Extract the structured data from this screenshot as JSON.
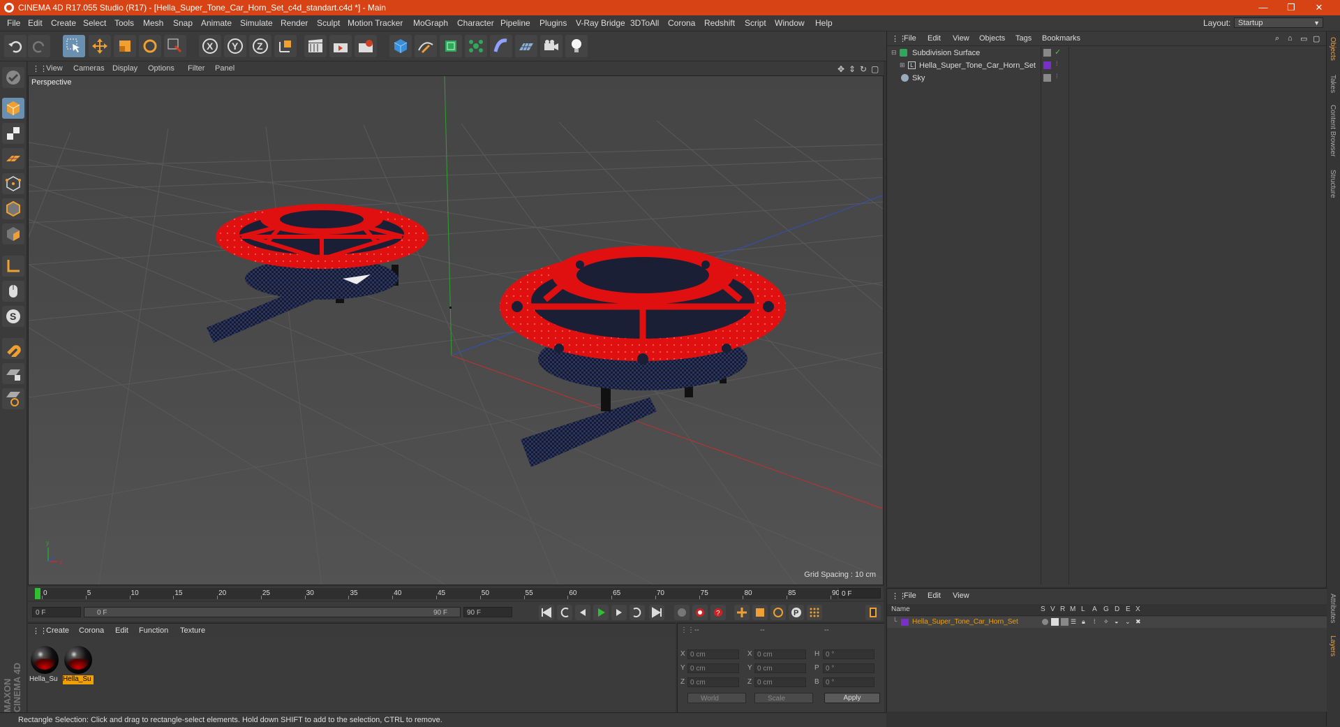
{
  "app": {
    "title": "CINEMA 4D R17.055 Studio (R17) - [Hella_Super_Tone_Car_Horn_Set_c4d_standart.c4d *] - Main",
    "window_controls": [
      "—",
      "❐",
      "✕"
    ]
  },
  "menubar": {
    "items": [
      "File",
      "Edit",
      "Create",
      "Select",
      "Tools",
      "Mesh",
      "Snap",
      "Animate",
      "Simulate",
      "Render",
      "Sculpt",
      "Motion Tracker",
      "MoGraph",
      "Character",
      "Pipeline",
      "Plugins",
      "V-Ray Bridge",
      "3DToAll",
      "Corona",
      "Redshift",
      "Script",
      "Window",
      "Help"
    ],
    "layout_label": "Layout:",
    "layout_value": "Startup"
  },
  "viewport": {
    "menu": [
      "View",
      "Cameras",
      "Display",
      "Options",
      "Filter",
      "Panel"
    ],
    "label": "Perspective",
    "grid_spacing": "Grid Spacing : 10 cm"
  },
  "object_manager": {
    "menu": [
      "File",
      "Edit",
      "View",
      "Objects",
      "Tags",
      "Bookmarks"
    ],
    "objects": [
      {
        "name": "Subdivision Surface"
      },
      {
        "name": "Hella_Super_Tone_Car_Horn_Set"
      },
      {
        "name": "Sky"
      }
    ]
  },
  "right_tabs": [
    "Objects",
    "Takes",
    "Content Browser",
    "Structure",
    "Attributes",
    "Layers"
  ],
  "layer_manager": {
    "menu": [
      "File",
      "Edit",
      "View"
    ],
    "columns": [
      "Name",
      "S",
      "V",
      "R",
      "M",
      "L",
      "A",
      "G",
      "D",
      "E",
      "X"
    ],
    "layer_name": "Hella_Super_Tone_Car_Horn_Set",
    "layer_color": "#7a2fc8"
  },
  "timeline": {
    "ticks": [
      "0",
      "5",
      "10",
      "15",
      "20",
      "25",
      "30",
      "35",
      "40",
      "45",
      "50",
      "55",
      "60",
      "65",
      "70",
      "75",
      "80",
      "85",
      "90"
    ],
    "current_frame": "0 F"
  },
  "transport": {
    "start_field": "0 F",
    "range_start": "0 F",
    "range_end": "90 F",
    "end_field": "90 F"
  },
  "material_manager": {
    "menu": [
      "Create",
      "Corona",
      "Edit",
      "Function",
      "Texture"
    ],
    "materials": [
      {
        "label": "Hella_Su"
      },
      {
        "label": "Hella_Su"
      }
    ]
  },
  "coordinates": {
    "headers": [
      "--",
      "--",
      "--"
    ],
    "rows": [
      {
        "l1": "X",
        "v1": "0 cm",
        "l2": "X",
        "v2": "0 cm",
        "l3": "H",
        "v3": "0 °"
      },
      {
        "l1": "Y",
        "v1": "0 cm",
        "l2": "Y",
        "v2": "0 cm",
        "l3": "P",
        "v3": "0 °"
      },
      {
        "l1": "Z",
        "v1": "0 cm",
        "l2": "Z",
        "v2": "0 cm",
        "l3": "B",
        "v3": "0 °"
      }
    ],
    "mode1": "World",
    "mode2": "Scale",
    "apply": "Apply"
  },
  "statusbar": {
    "text": "Rectangle Selection: Click and drag to rectangle-select elements. Hold down SHIFT to add to the selection, CTRL to remove."
  },
  "brand": {
    "text": "MAXON CINEMA 4D"
  },
  "colors": {
    "title_bar": "#d84315",
    "horn_red": "#e01010",
    "selection_orange": "#f0a000",
    "axis_x": "#c03030",
    "axis_y": "#30a030",
    "axis_z": "#3050c0"
  }
}
